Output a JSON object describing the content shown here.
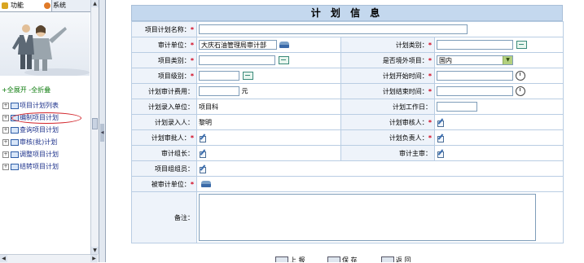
{
  "sidebar": {
    "tabs": [
      "功能",
      "系统"
    ],
    "expand_all": "+全展开",
    "collapse_all": "-全折叠",
    "tree": [
      "项目计划列表",
      "编制项目计划",
      "查询项目计划",
      "审核(批)计划",
      "调整项目计划",
      "结转项目计划"
    ]
  },
  "form": {
    "title": "计 划 信 息",
    "plan_name_label": "项目计划名称：",
    "audit_unit_label": "审计单位：",
    "audit_unit_value": "大庆石油管理局审计部",
    "plan_type_label": "计划类别：",
    "project_type_label": "项目类别：",
    "overseas_label": "是否境外项目：",
    "overseas_value": "国内",
    "project_level_label": "项目级别：",
    "plan_start_label": "计划开始时间：",
    "audit_cost_label": "计划审计费用：",
    "cost_unit": "元",
    "plan_end_label": "计划结束时间：",
    "entry_unit_label": "计划录入单位：",
    "entry_unit_value": "项目科",
    "work_days_label": "计划工作日：",
    "entry_person_label": "计划录入人：",
    "entry_person_value": "黎明",
    "auditor_label": "计划审核人：",
    "approver_label": "计划审批人：",
    "responsible_label": "计划负责人：",
    "audit_leader_label": "审计组长：",
    "audit_supervisor_label": "审计主审：",
    "team_members_label": "项目组组员：",
    "audited_unit_label": "被审计单位：",
    "remarks_label": "备注："
  },
  "buttons": [
    "上 报",
    "保 存",
    "返 回"
  ]
}
